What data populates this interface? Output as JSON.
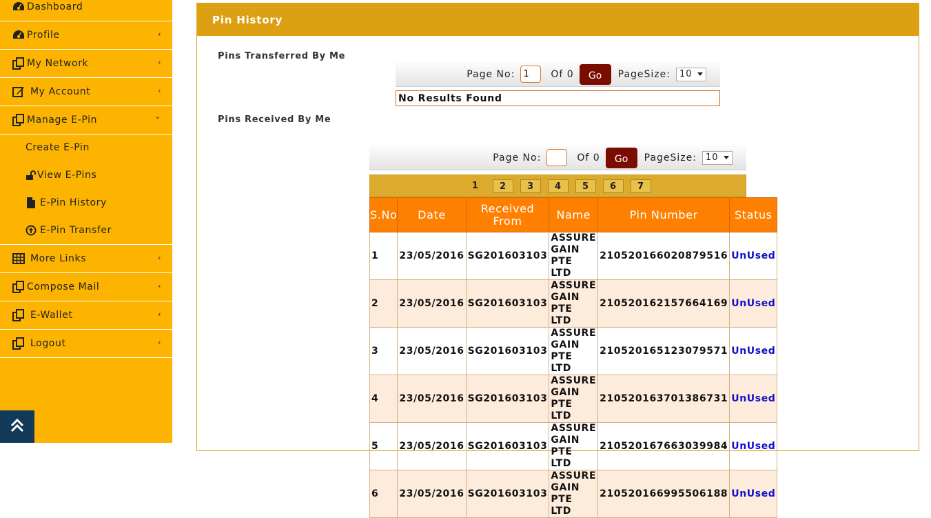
{
  "sidebar": {
    "items": [
      {
        "label": "Dashboard",
        "icon": "dashboard-icon",
        "chevron": ""
      },
      {
        "label": "Profile",
        "icon": "dashboard-icon",
        "chevron": "‹"
      },
      {
        "label": "My Network",
        "icon": "copy-icon",
        "chevron": "‹"
      },
      {
        "label": "My Account",
        "icon": "edit-icon",
        "chevron": "‹"
      },
      {
        "label": "Manage E-Pin",
        "icon": "copy-icon",
        "chevron": "⌄"
      },
      {
        "label": "More Links",
        "icon": "table-icon",
        "chevron": "‹"
      },
      {
        "label": "Compose Mail",
        "icon": "copy-icon",
        "chevron": "‹"
      },
      {
        "label": "E-Wallet",
        "icon": "copy-icon",
        "chevron": "‹"
      },
      {
        "label": "Logout",
        "icon": "copy-icon",
        "chevron": "‹"
      }
    ],
    "sub_items": [
      {
        "label": "Create E-Pin",
        "icon": ""
      },
      {
        "label": "View E-Pins",
        "icon": "unlock-icon"
      },
      {
        "label": "E-Pin History",
        "icon": "file-icon"
      },
      {
        "label": "E-Pin Transfer",
        "icon": "arrow-up-circle-icon"
      }
    ]
  },
  "panel": {
    "title": "Pin History"
  },
  "transferred": {
    "title": "Pins Transferred By Me",
    "page_label": "Page No:",
    "page_value": "1",
    "of_label": "Of 0",
    "go_label": "Go",
    "pagesize_label": "PageSize:",
    "pagesize_value": "10",
    "no_results": "No Results Found"
  },
  "received": {
    "title": "Pins Received By Me",
    "page_label": "Page No:",
    "page_value": "",
    "of_label": "Of 0",
    "go_label": "Go",
    "pagesize_label": "PageSize:",
    "pagesize_value": "10",
    "pages": [
      "1",
      "2",
      "3",
      "4",
      "5",
      "6",
      "7"
    ],
    "columns": [
      "S.No",
      "Date",
      "Received From",
      "Name",
      "Pin Number",
      "Status"
    ],
    "rows": [
      {
        "sno": "1",
        "date": "23/05/2016",
        "from": "SG201603103",
        "name": "ASSURE GAIN PTE LTD",
        "pin": "210520166020879516",
        "status": "UnUsed"
      },
      {
        "sno": "2",
        "date": "23/05/2016",
        "from": "SG201603103",
        "name": "ASSURE GAIN PTE LTD",
        "pin": "210520162157664169",
        "status": "UnUsed"
      },
      {
        "sno": "3",
        "date": "23/05/2016",
        "from": "SG201603103",
        "name": "ASSURE GAIN PTE LTD",
        "pin": "210520165123079571",
        "status": "UnUsed"
      },
      {
        "sno": "4",
        "date": "23/05/2016",
        "from": "SG201603103",
        "name": "ASSURE GAIN PTE LTD",
        "pin": "210520163701386731",
        "status": "UnUsed"
      },
      {
        "sno": "5",
        "date": "23/05/2016",
        "from": "SG201603103",
        "name": "ASSURE GAIN PTE LTD",
        "pin": "210520167663039984",
        "status": "UnUsed"
      },
      {
        "sno": "6",
        "date": "23/05/2016",
        "from": "SG201603103",
        "name": "ASSURE GAIN PTE LTD",
        "pin": "210520166995506188",
        "status": "UnUsed"
      }
    ]
  },
  "colors": {
    "sidebar_bg": "#fdb400",
    "header_bg": "#dca012",
    "table_header_bg": "#ff7f00",
    "go_button_bg": "#7b0c00",
    "status_color": "#1010c8"
  }
}
